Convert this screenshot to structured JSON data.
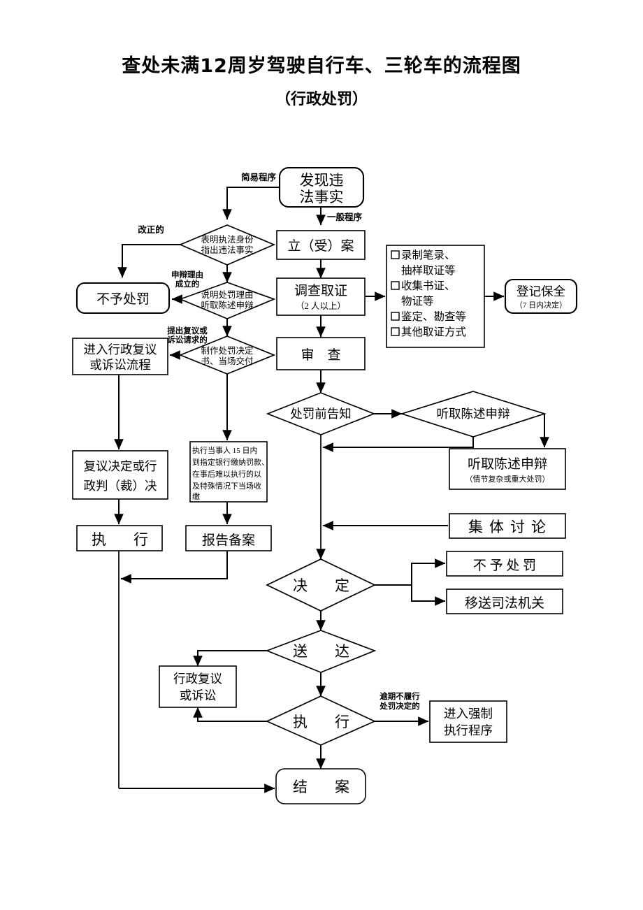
{
  "document": {
    "title": "查处未满12周岁驾驶自行车、三轮车的流程图",
    "subtitle": "（行政处罚）"
  },
  "chart_data": {
    "type": "diagram",
    "title": "查处未满12周岁驾驶自行车、三轮车的流程图",
    "subtitle": "（行政处罚）",
    "orientation": "top-to-bottom",
    "nodes": [
      {
        "id": "n1",
        "shape": "rounded-rect",
        "label": "发现违\n法事实"
      },
      {
        "id": "n2",
        "shape": "diamond",
        "label": "表明执法身份\n指出违法事实"
      },
      {
        "id": "n3",
        "shape": "rect",
        "label": "立（受）案"
      },
      {
        "id": "n4",
        "shape": "rounded-rect",
        "label": "不予处罚"
      },
      {
        "id": "n5",
        "shape": "diamond",
        "label": "说明处罚理由\n听取陈述申辩"
      },
      {
        "id": "n6",
        "shape": "rect",
        "label": "调查取证",
        "sublabel": "（2 人以上）"
      },
      {
        "id": "n7",
        "shape": "rect",
        "label": "录制笔录、抽样取证等 / 收集书证、物证等 / 鉴定、勘查等 / 其他取证方式"
      },
      {
        "id": "n8",
        "shape": "rounded-rect",
        "label": "登记保全",
        "sublabel": "（7 日内决定）"
      },
      {
        "id": "n9",
        "shape": "rect",
        "label": "进入行政复议\n或诉讼流程"
      },
      {
        "id": "n10",
        "shape": "diamond",
        "label": "制作处罚决定\n书、当场交付"
      },
      {
        "id": "n11",
        "shape": "rect",
        "label": "审　查"
      },
      {
        "id": "n12",
        "shape": "diamond",
        "label": "处罚前告知"
      },
      {
        "id": "n13",
        "shape": "diamond",
        "label": "听取陈述申辩"
      },
      {
        "id": "n14",
        "shape": "rect",
        "label": "听取陈述申辩",
        "sublabel": "（情节复杂或重大处罚）"
      },
      {
        "id": "n15",
        "shape": "rect",
        "label": "复议决定或行\n政判（裁）决"
      },
      {
        "id": "n16",
        "shape": "rect",
        "label": "执行当事人 15 日内到指定银行缴纳罚款、在事后难以执行的以及特殊情况下当场收缴"
      },
      {
        "id": "n17",
        "shape": "rect",
        "label": "执　行"
      },
      {
        "id": "n18",
        "shape": "rect",
        "label": "报告备案"
      },
      {
        "id": "n19",
        "shape": "rect",
        "label": "集体讨论"
      },
      {
        "id": "n20",
        "shape": "diamond",
        "label": "决　定"
      },
      {
        "id": "n21",
        "shape": "rect",
        "label": "不予处罚"
      },
      {
        "id": "n22",
        "shape": "rect",
        "label": "移送司法机关"
      },
      {
        "id": "n23",
        "shape": "diamond",
        "label": "送　达"
      },
      {
        "id": "n24",
        "shape": "rect",
        "label": "行政复议\n或诉讼"
      },
      {
        "id": "n25",
        "shape": "diamond",
        "label": "执　行"
      },
      {
        "id": "n26",
        "shape": "rect",
        "label": "进入强制\n执行程序"
      },
      {
        "id": "n27",
        "shape": "rounded-rect",
        "label": "结　案"
      }
    ],
    "edge_labels": [
      "简易程序",
      "一般程序",
      "改正的",
      "申辩理由成立的",
      "提出复议或诉讼请求的",
      "逾期不履行处罚决定的"
    ]
  },
  "nodes": {
    "discover": {
      "line1": "发现违",
      "line2": "法事实"
    },
    "show_identity": {
      "line1": "表明执法身份",
      "line2": "指出违法事实"
    },
    "file_case": {
      "text": "立（受）案"
    },
    "no_penalty_1": {
      "text": "不予处罚"
    },
    "explain_reason": {
      "line1": "说明处罚理由",
      "line2": "听取陈述申辩"
    },
    "investigate": {
      "text": "调查取证",
      "sub": "（2 人以上）"
    },
    "evidence_list": {
      "items": [
        "录制笔录、",
        "抽样取证等",
        "收集书证、",
        "物证等",
        "鉴定、勘查等",
        "其他取证方式"
      ]
    },
    "registration": {
      "text": "登记保全",
      "sub": "（7 日内决定）"
    },
    "enter_review": {
      "line1": "进入行政复议",
      "line2": "或诉讼流程"
    },
    "make_decision": {
      "line1": "制作处罚决定",
      "line2": "书、当场交付"
    },
    "examine": {
      "text": "审　查"
    },
    "pre_notice": {
      "text": "处罚前告知"
    },
    "hear_statement_d": {
      "text": "听取陈述申辩"
    },
    "hear_statement_b": {
      "text": "听取陈述申辩",
      "sub": "（情节复杂或重大处罚）"
    },
    "review_verdict": {
      "line1": "复议决定或行",
      "line2": "政判（裁）决"
    },
    "payment_note": {
      "line1": "执行当事人 15 日内",
      "line2": "到指定银行缴纳罚款、",
      "line3": "在事后难以执行的以",
      "line4": "及特殊情况下当场收",
      "line5": "缴"
    },
    "execute_left": {
      "text": "执　行"
    },
    "report_record": {
      "text": "报告备案"
    },
    "group_discuss": {
      "text": "集体讨论"
    },
    "decision": {
      "text": "决　定"
    },
    "no_penalty_2": {
      "text": "不 予 处 罚"
    },
    "transfer_judicial": {
      "text": "移送司法机关"
    },
    "deliver": {
      "text": "送　达"
    },
    "admin_review": {
      "line1": "行政复议",
      "line2": "或诉讼"
    },
    "execute_d": {
      "text": "执　行"
    },
    "forced_exec": {
      "line1": "进入强制",
      "line2": "执行程序"
    },
    "close_case": {
      "text": "结　案"
    }
  },
  "edge_labels": {
    "simple_procedure": {
      "text": "简易程序"
    },
    "general_procedure": {
      "text": "一般程序"
    },
    "corrected": {
      "text": "改正的"
    },
    "plea_valid": {
      "line1": "申辩理由",
      "line2": "成立的"
    },
    "request_review": {
      "line1": "提出复议或",
      "line2": "诉讼请求的"
    },
    "overdue": {
      "line1": "逾期不履行",
      "line2": "处罚决定的"
    }
  },
  "colors": {
    "stroke": "#000000",
    "fill": "#ffffff",
    "background": "#ffffff"
  }
}
